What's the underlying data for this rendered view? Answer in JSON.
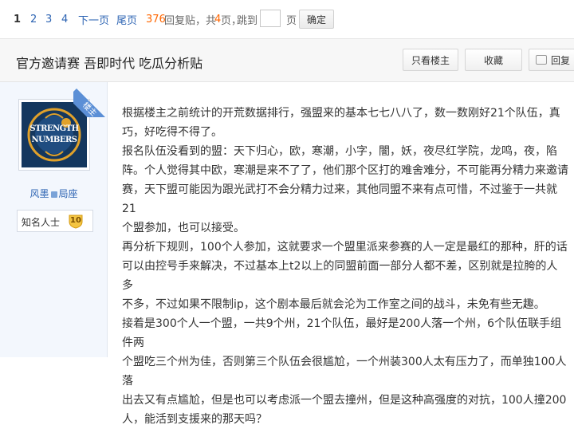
{
  "pager": {
    "current": "1",
    "pages": [
      "2",
      "3",
      "4"
    ],
    "next": "下一页",
    "last": "尾页",
    "reply_count": "376",
    "reply_text": "回复贴，共",
    "page_total": "4",
    "page_unit": "页，",
    "goto_text": "跳到",
    "page_input_value": "",
    "page_suffix": "页",
    "confirm": "确定"
  },
  "thread": {
    "title": "官方邀请赛 吾即时代 吃瓜分析贴",
    "only_author": "只看楼主",
    "collect": "收藏",
    "reply": "回复"
  },
  "author": {
    "ribbon": "楼主",
    "avatar_text_1": "STRENGTH",
    "avatar_text_2": "NUMBERS",
    "name_left": "风墨",
    "name_right": "局座",
    "rank_name": "知名人士",
    "rank_level": "10"
  },
  "post": {
    "lines": [
      "根据楼主之前统计的开荒数据排行，强盟来的基本七七八八了，数一数刚好21个队伍，真",
      "巧，好吃得不得了。",
      "报名队伍没看到的盟：天下归心，欧，寒潮，小字，闇，妖，夜尽红学院，龙鸣，夜，陷",
      "阵。个人觉得其中欧，寒潮是来不了了，他们那个区打的难舍难分，不可能再分精力来邀请",
      "赛，天下盟可能因为跟光武打不会分精力过来，其他同盟不来有点可惜，不过鉴于一共就21",
      "个盟参加，也可以接受。",
      "再分析下规则，100个人参加，这就要求一个盟里派来参赛的人一定是最红的那种，肝的话",
      "可以由控号手来解决，不过基本上t2以上的同盟前面一部分人都不差，区别就是拉胯的人多",
      "不多，不过如果不限制ip，这个剧本最后就会沦为工作室之间的战斗，未免有些无趣。",
      "接着是300个人一个盟，一共9个州，21个队伍，最好是200人落一个州，6个队伍联手组件两",
      "个盟吃三个州为佳，否则第三个队伍会很尴尬，一个州装300人太有压力了，而单独100人落",
      "出去又有点尴尬，但是也可以考虑派一个盟去撞州，但是这种高强度的对抗，100人撞200",
      "人，能活到支援来的那天吗？"
    ]
  }
}
